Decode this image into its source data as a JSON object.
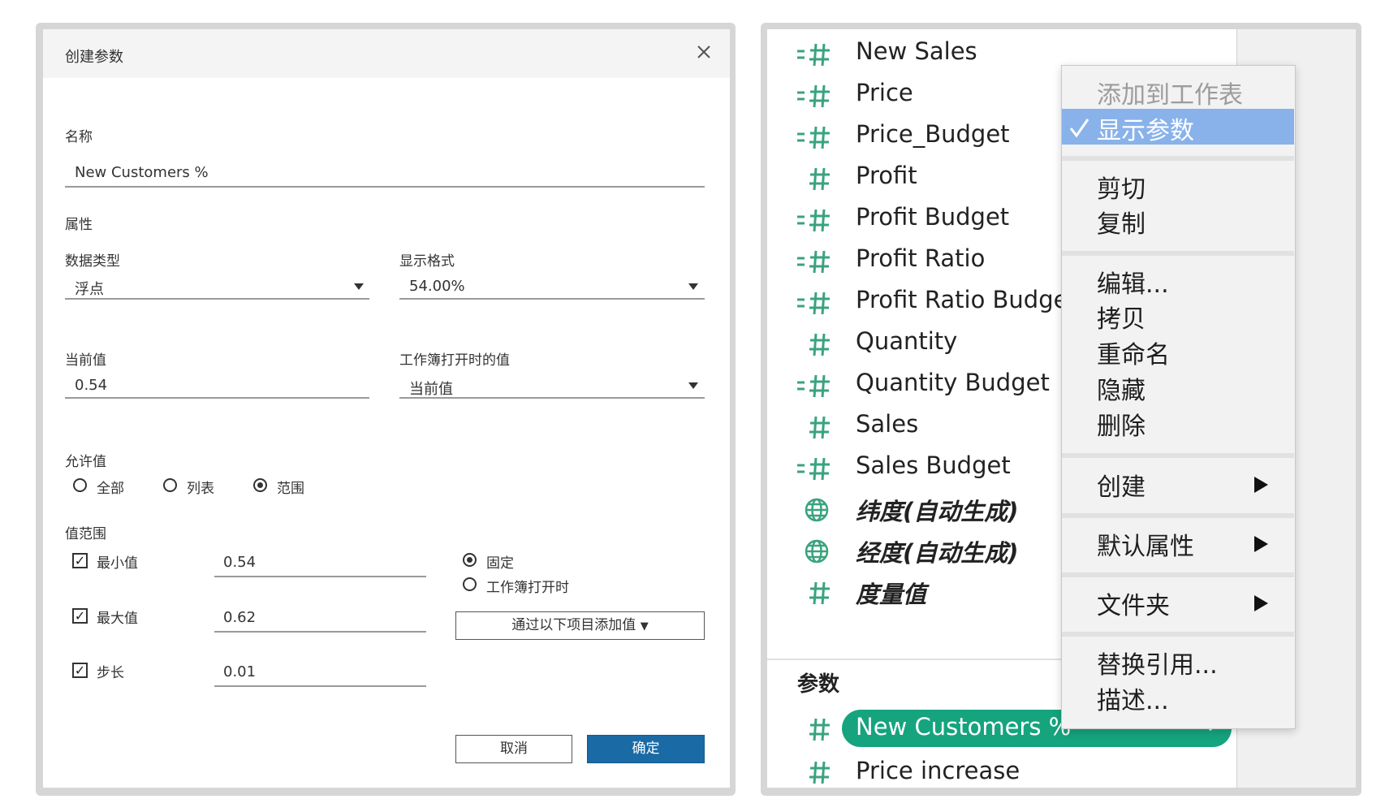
{
  "dialog": {
    "title": "创建参数",
    "name_label": "名称",
    "name_value": "New Customers %",
    "properties_label": "属性",
    "data_type_label": "数据类型",
    "data_type_value": "浮点",
    "display_format_label": "显示格式",
    "display_format_value": "54.00%",
    "current_value_label": "当前值",
    "current_value": "0.54",
    "workbook_open_label": "工作簿打开时的值",
    "workbook_open_value": "当前值",
    "allowable_label": "允许值",
    "allowable_options": [
      "全部",
      "列表",
      "范围"
    ],
    "allowable_selected": "范围",
    "range_label": "值范围",
    "min_label": "最小值",
    "min_value": "0.54",
    "max_label": "最大值",
    "max_value": "0.62",
    "step_label": "步长",
    "step_value": "0.01",
    "fixed_label": "固定",
    "on_open_label": "工作簿打开时",
    "add_from_label": "通过以下项目添加值",
    "cancel_label": "取消",
    "ok_label": "确定"
  },
  "fields": [
    {
      "name": "New Sales",
      "icon": "calc-hash-icon"
    },
    {
      "name": "Price",
      "icon": "calc-hash-icon"
    },
    {
      "name": "Price_Budget",
      "icon": "calc-hash-icon"
    },
    {
      "name": "Profit",
      "icon": "hash-icon"
    },
    {
      "name": "Profit Budget",
      "icon": "calc-hash-icon"
    },
    {
      "name": "Profit Ratio",
      "icon": "calc-hash-icon"
    },
    {
      "name": "Profit Ratio Budget",
      "icon": "calc-hash-icon"
    },
    {
      "name": "Quantity",
      "icon": "hash-icon"
    },
    {
      "name": "Quantity Budget",
      "icon": "calc-hash-icon"
    },
    {
      "name": "Sales",
      "icon": "hash-icon"
    },
    {
      "name": "Sales Budget",
      "icon": "calc-hash-icon"
    },
    {
      "name": "纬度(自动生成)",
      "icon": "globe-icon"
    },
    {
      "name": "经度(自动生成)",
      "icon": "globe-icon"
    },
    {
      "name": "度量值",
      "icon": "hash-icon"
    }
  ],
  "parameters": {
    "title": "参数",
    "items": [
      {
        "name": "New Customers %",
        "icon": "hash-icon",
        "selected": true
      },
      {
        "name": "Price increase",
        "icon": "hash-icon",
        "selected": false
      }
    ]
  },
  "menu": {
    "add_to_sheet": "添加到工作表",
    "show_parameter": "显示参数",
    "cut": "剪切",
    "copy": "复制",
    "edit": "编辑...",
    "duplicate": "拷贝",
    "rename": "重命名",
    "hide": "隐藏",
    "delete": "删除",
    "create": "创建",
    "default_properties": "默认属性",
    "folder": "文件夹",
    "replace_references": "替换引用...",
    "describe": "描述..."
  },
  "colors": {
    "field_icon": "#3aa37e",
    "pill": "#15a47e",
    "menu_highlight": "#89b2ea",
    "primary_button": "#1a6aa5"
  }
}
